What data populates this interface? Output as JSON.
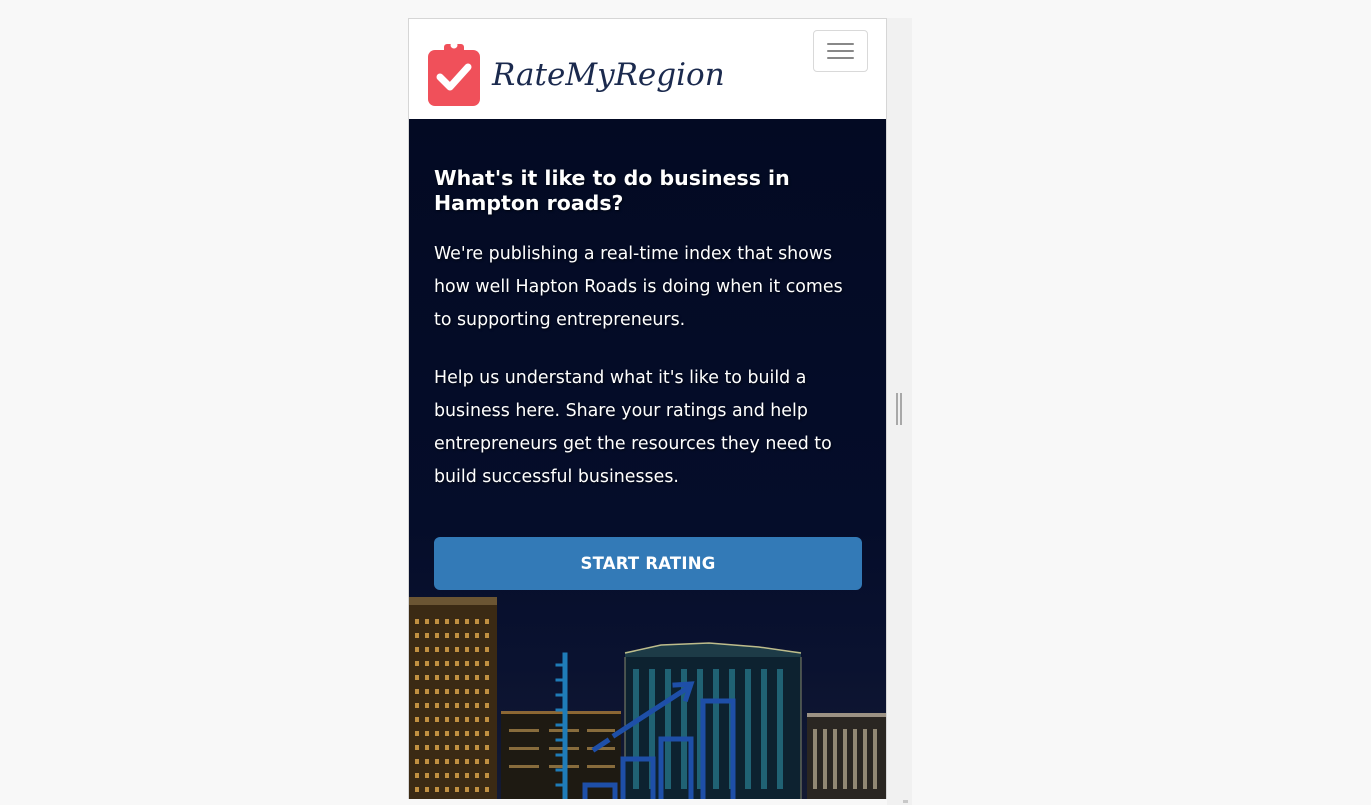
{
  "navbar": {
    "brand_name": "RateMyRegion",
    "logo_icon": "clipboard-check-icon",
    "menu_icon": "hamburger-menu-icon"
  },
  "hero": {
    "title": "What's it like to do business in Hampton roads?",
    "paragraph_1": "We're publishing a real-time index that shows how well Hapton Roads is doing when it comes to supporting entrepreneurs.",
    "paragraph_2": "Help us understand what it's like to build a business here. Share your ratings and help entrepreneurs get the resources they need to build successful businesses.",
    "cta_label": "START RATING",
    "background_image": "city-skyline-at-night-with-growth-chart-graphic"
  },
  "colors": {
    "brand_accent": "#f0505a",
    "brand_text": "#1b2a4e",
    "hero_background": "#030a23",
    "cta_background": "#337ab7",
    "cta_text": "#ffffff"
  }
}
